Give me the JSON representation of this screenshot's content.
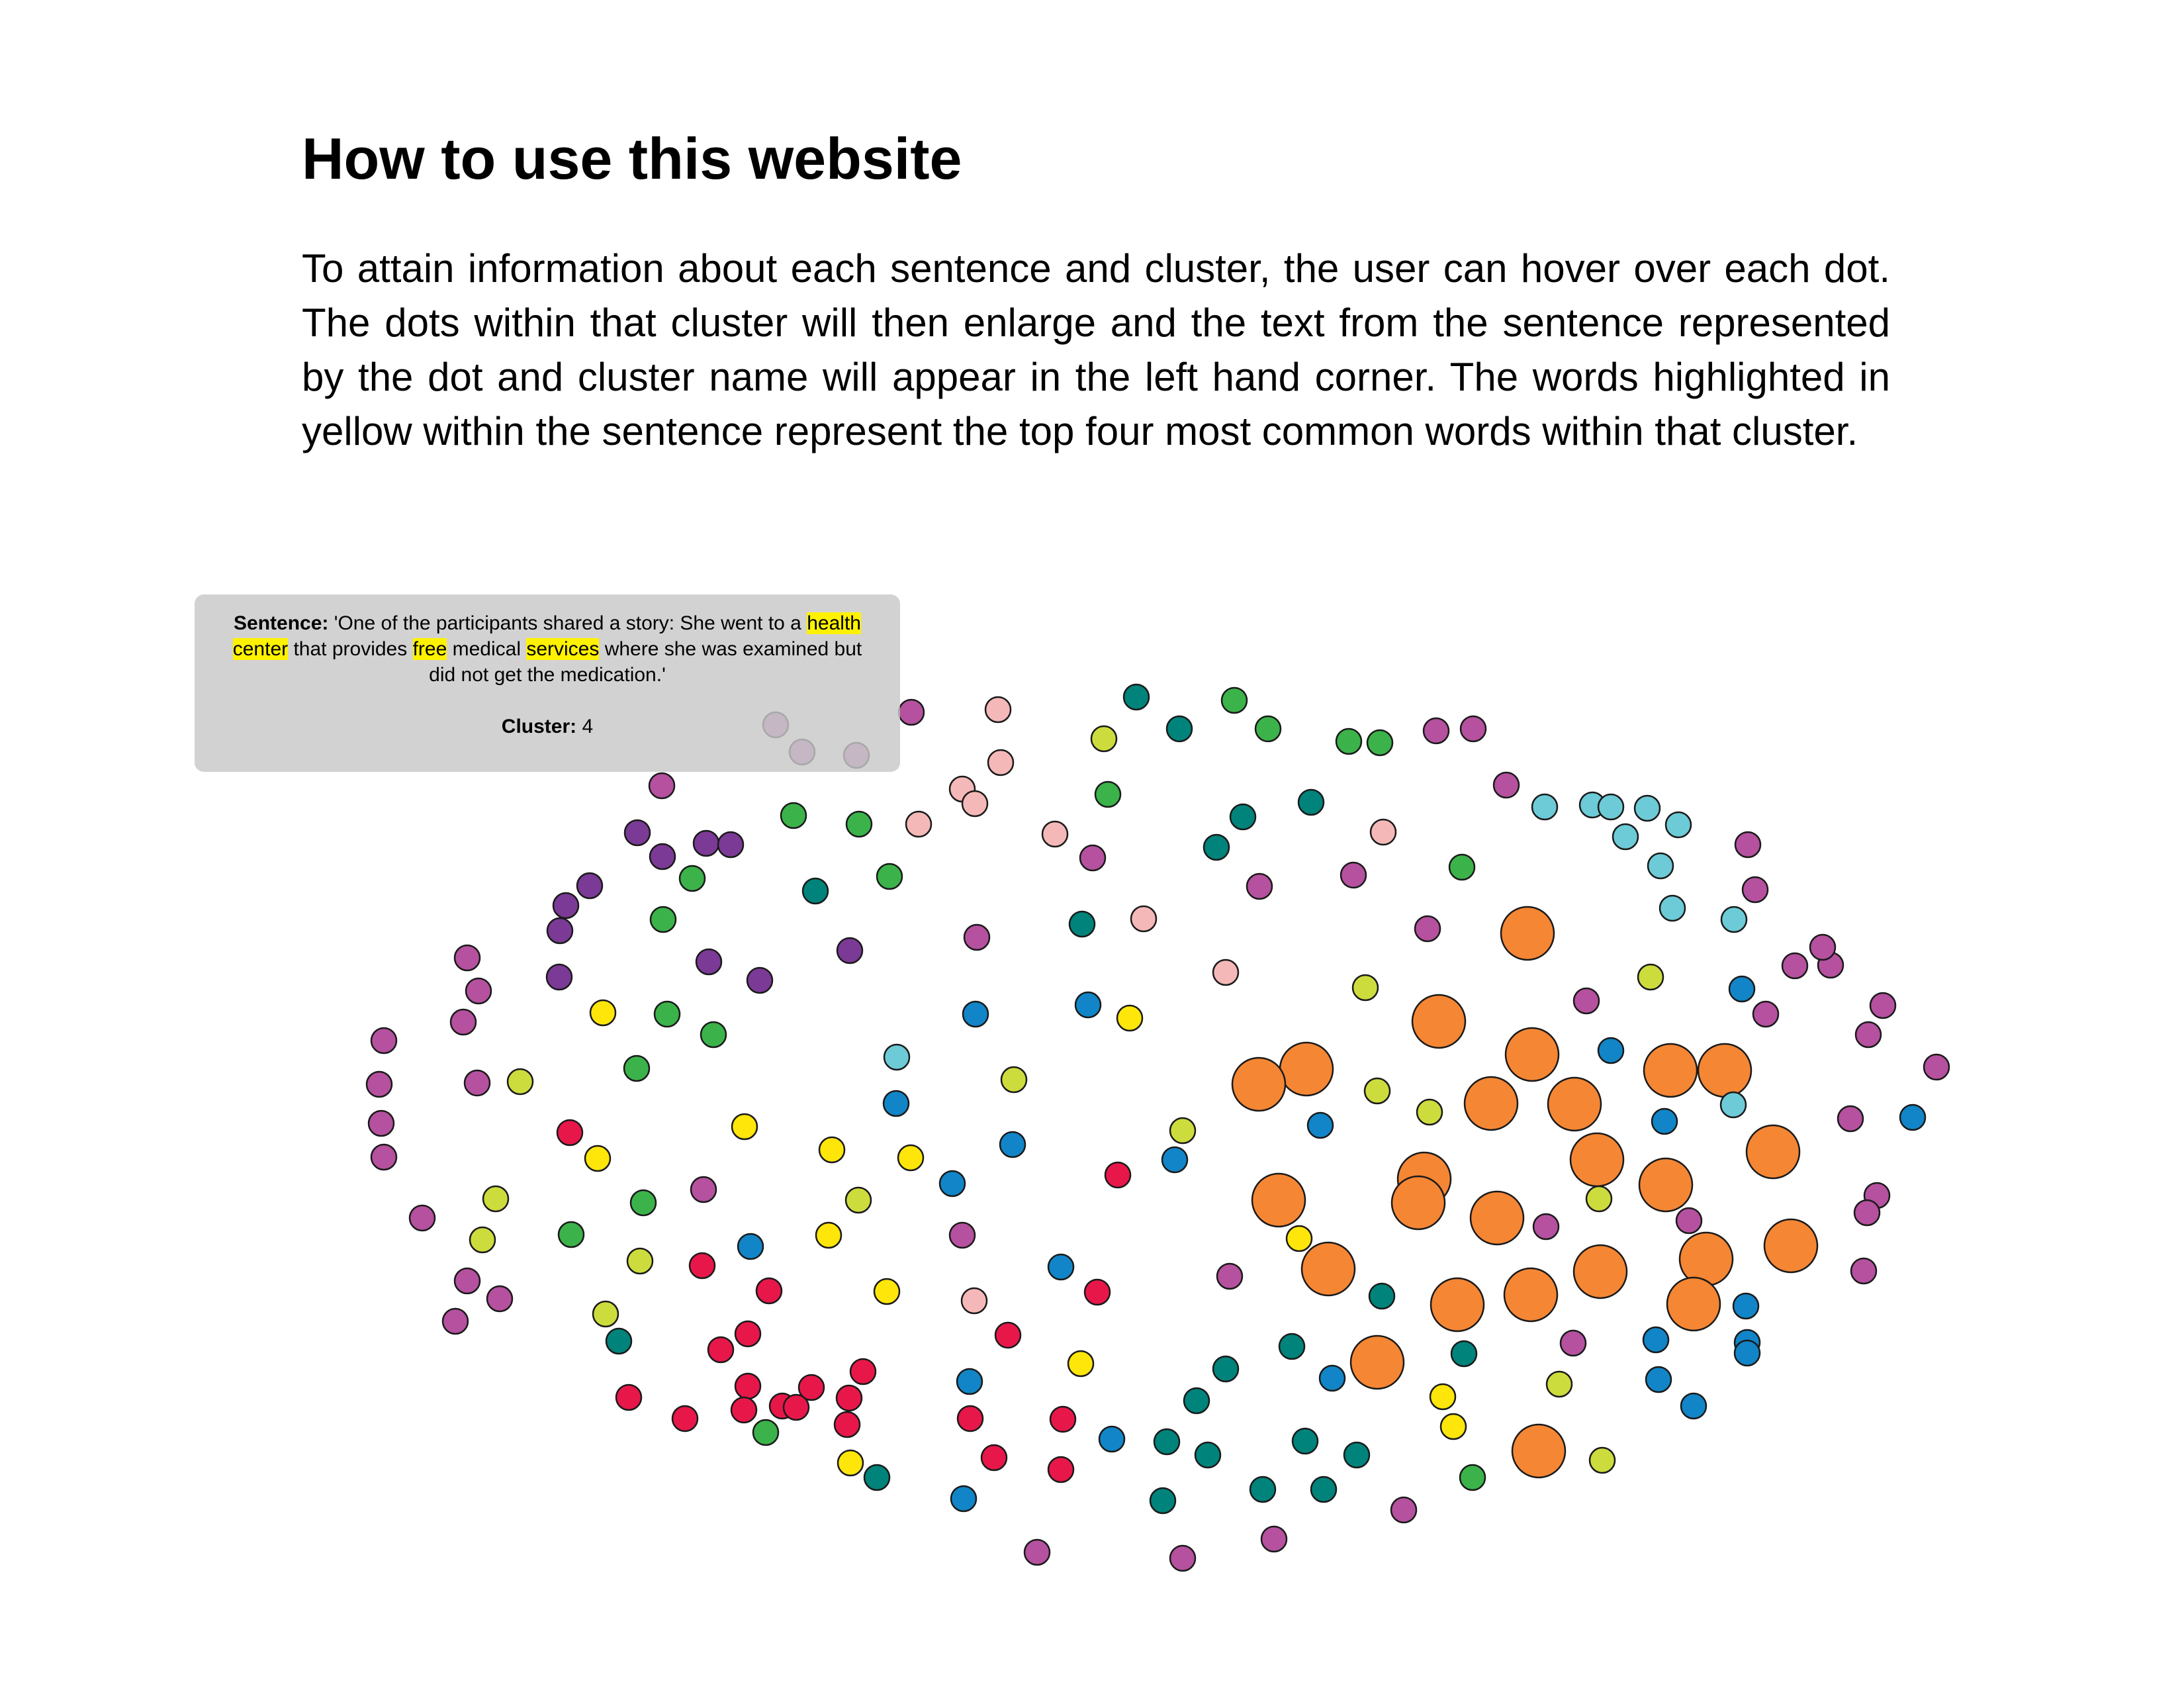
{
  "title": "How to use this website",
  "intro": "To attain information about each sentence and cluster, the user can hover over each dot.  The dots within that cluster will then enlarge and the text from the sentence represented by the dot and cluster name will appear in the left hand corner.  The words highlighted in yellow within the sentence represent the top four most common words within that cluster.",
  "tooltip": {
    "sentence_label": "Sentence:",
    "sentence_parts": [
      {
        "text": " 'One of the participants shared a story: She went to a ",
        "highlight": false
      },
      {
        "text": "health",
        "highlight": true
      },
      {
        "text": " ",
        "highlight": false
      },
      {
        "text": "center",
        "highlight": true
      },
      {
        "text": " that provides ",
        "highlight": false
      },
      {
        "text": "free",
        "highlight": true
      },
      {
        "text": " medical ",
        "highlight": false
      },
      {
        "text": "services",
        "highlight": true
      },
      {
        "text": " where she was examined but did not get the medication.'",
        "highlight": false
      }
    ],
    "cluster_label": "Cluster:",
    "cluster_value": "4"
  },
  "colors": {
    "magenta": "#b5519f",
    "purple": "#7b3a96",
    "green": "#3bb34a",
    "teal": "#00837a",
    "lightblue": "#6ccbd6",
    "pink": "#f5b8b8",
    "lime": "#cddc3d",
    "yellow": "#ffe60a",
    "red": "#e8174a",
    "blue": "#1185c7",
    "orange": "#f58634",
    "lavender": "#b768b0"
  },
  "dots": [
    [
      1717,
      1053,
      "teal"
    ],
    [
      1865,
      1058,
      "green"
    ],
    [
      1508,
      1072,
      "pink"
    ],
    [
      1377,
      1076,
      "magenta"
    ],
    [
      1668,
      1116,
      "lime"
    ],
    [
      1782,
      1101,
      "teal"
    ],
    [
      1916,
      1101,
      "green"
    ],
    [
      2038,
      1120,
      "green"
    ],
    [
      2085,
      1122,
      "green"
    ],
    [
      2170,
      1104,
      "magenta"
    ],
    [
      2226,
      1101,
      "magenta"
    ],
    [
      1512,
      1152,
      "pink"
    ],
    [
      1000,
      1187,
      "magenta"
    ],
    [
      1674,
      1200,
      "green"
    ],
    [
      1454,
      1192,
      "pink"
    ],
    [
      1473,
      1214,
      "pink"
    ],
    [
      1388,
      1245,
      "pink"
    ],
    [
      1199,
      1232,
      "green"
    ],
    [
      1298,
      1245,
      "green"
    ],
    [
      1878,
      1234,
      "teal"
    ],
    [
      1981,
      1212,
      "teal"
    ],
    [
      2090,
      1257,
      "pink"
    ],
    [
      2276,
      1186,
      "magenta"
    ],
    [
      2334,
      1219,
      "lightblue"
    ],
    [
      2406,
      1216,
      "lightblue"
    ],
    [
      2434,
      1219,
      "lightblue"
    ],
    [
      2489,
      1221,
      "lightblue"
    ],
    [
      2536,
      1246,
      "lightblue"
    ],
    [
      2456,
      1264,
      "lightblue"
    ],
    [
      963,
      1258,
      "purple"
    ],
    [
      1001,
      1294,
      "purple"
    ],
    [
      1067,
      1274,
      "purple"
    ],
    [
      1104,
      1276,
      "purple"
    ],
    [
      1046,
      1327,
      "green"
    ],
    [
      1594,
      1260,
      "pink"
    ],
    [
      1651,
      1296,
      "magenta"
    ],
    [
      1838,
      1280,
      "teal"
    ],
    [
      1232,
      1346,
      "teal"
    ],
    [
      1344,
      1324,
      "green"
    ],
    [
      2045,
      1322,
      "magenta"
    ],
    [
      2209,
      1310,
      "green"
    ],
    [
      2509,
      1308,
      "lightblue"
    ],
    [
      2641,
      1276,
      "magenta"
    ],
    [
      2652,
      1344,
      "magenta"
    ],
    [
      855,
      1368,
      "purple"
    ],
    [
      891,
      1338,
      "purple"
    ],
    [
      846,
      1406,
      "purple"
    ],
    [
      1903,
      1339,
      "magenta"
    ],
    [
      2527,
      1372,
      "lightblue"
    ],
    [
      2620,
      1389,
      "lightblue"
    ],
    [
      1002,
      1389,
      "green"
    ],
    [
      1728,
      1388,
      "pink"
    ],
    [
      1635,
      1396,
      "teal"
    ],
    [
      1476,
      1416,
      "magenta"
    ],
    [
      1284,
      1436,
      "purple"
    ],
    [
      1071,
      1453,
      "purple"
    ],
    [
      1148,
      1481,
      "purple"
    ],
    [
      845,
      1476,
      "purple"
    ],
    [
      706,
      1447,
      "magenta"
    ],
    [
      723,
      1497,
      "magenta"
    ],
    [
      2157,
      1403,
      "magenta"
    ],
    [
      2308,
      1410,
      "orange",
      40
    ],
    [
      1852,
      1469,
      "pink"
    ],
    [
      2063,
      1492,
      "lime"
    ],
    [
      2494,
      1476,
      "lime"
    ],
    [
      2712,
      1459,
      "magenta"
    ],
    [
      2766,
      1458,
      "magenta"
    ],
    [
      2754,
      1431,
      "magenta"
    ],
    [
      2632,
      1494,
      "blue"
    ],
    [
      2668,
      1532,
      "magenta"
    ],
    [
      2845,
      1519,
      "magenta"
    ],
    [
      2823,
      1563,
      "magenta"
    ],
    [
      700,
      1544,
      "magenta"
    ],
    [
      580,
      1572,
      "magenta"
    ],
    [
      911,
      1530,
      "yellow"
    ],
    [
      1008,
      1532,
      "green"
    ],
    [
      1078,
      1563,
      "green"
    ],
    [
      1474,
      1532,
      "blue"
    ],
    [
      1644,
      1518,
      "blue"
    ],
    [
      1707,
      1538,
      "yellow"
    ],
    [
      2174,
      1543,
      "orange",
      40
    ],
    [
      2397,
      1512,
      "magenta"
    ],
    [
      962,
      1614,
      "green"
    ],
    [
      1355,
      1597,
      "lightblue"
    ],
    [
      573,
      1638,
      "magenta"
    ],
    [
      576,
      1697,
      "magenta"
    ],
    [
      580,
      1748,
      "magenta"
    ],
    [
      721,
      1636,
      "magenta"
    ],
    [
      786,
      1634,
      "lime"
    ],
    [
      1532,
      1631,
      "lime"
    ],
    [
      1354,
      1667,
      "blue"
    ],
    [
      1974,
      1615,
      "orange",
      40
    ],
    [
      1902,
      1638,
      "orange",
      40
    ],
    [
      2315,
      1593,
      "orange",
      40
    ],
    [
      2434,
      1587,
      "blue"
    ],
    [
      2081,
      1648,
      "lime"
    ],
    [
      2524,
      1617,
      "orange",
      40
    ],
    [
      2606,
      1617,
      "orange",
      40
    ],
    [
      2926,
      1612,
      "magenta"
    ],
    [
      2619,
      1669,
      "lightblue"
    ],
    [
      2890,
      1688,
      "blue"
    ],
    [
      2796,
      1690,
      "magenta"
    ],
    [
      2253,
      1667,
      "orange",
      40
    ],
    [
      2379,
      1668,
      "orange",
      40
    ],
    [
      861,
      1711,
      "red"
    ],
    [
      903,
      1750,
      "yellow"
    ],
    [
      1125,
      1702,
      "yellow"
    ],
    [
      1257,
      1737,
      "yellow"
    ],
    [
      1376,
      1749,
      "yellow"
    ],
    [
      1530,
      1729,
      "blue"
    ],
    [
      1787,
      1708,
      "lime"
    ],
    [
      1995,
      1700,
      "blue"
    ],
    [
      2160,
      1680,
      "lime"
    ],
    [
      2515,
      1694,
      "blue"
    ],
    [
      2679,
      1740,
      "orange",
      40
    ],
    [
      2413,
      1752,
      "orange",
      40
    ],
    [
      1439,
      1788,
      "blue"
    ],
    [
      1689,
      1775,
      "red"
    ],
    [
      1775,
      1752,
      "blue"
    ],
    [
      1063,
      1797,
      "magenta"
    ],
    [
      1297,
      1813,
      "lime"
    ],
    [
      749,
      1811,
      "lime"
    ],
    [
      972,
      1817,
      "green"
    ],
    [
      2152,
      1781,
      "orange",
      40
    ],
    [
      2517,
      1790,
      "orange",
      40
    ],
    [
      2143,
      1817,
      "orange",
      40
    ],
    [
      1932,
      1813,
      "orange",
      40
    ],
    [
      2836,
      1806,
      "magenta"
    ],
    [
      2821,
      1832,
      "magenta"
    ],
    [
      2416,
      1811,
      "lime"
    ],
    [
      638,
      1840,
      "magenta"
    ],
    [
      729,
      1873,
      "lime"
    ],
    [
      863,
      1865,
      "green"
    ],
    [
      1134,
      1883,
      "blue"
    ],
    [
      1252,
      1866,
      "yellow"
    ],
    [
      1454,
      1866,
      "magenta"
    ],
    [
      1963,
      1871,
      "yellow"
    ],
    [
      2262,
      1840,
      "orange",
      40
    ],
    [
      2336,
      1853,
      "magenta"
    ],
    [
      2552,
      1844,
      "magenta"
    ],
    [
      967,
      1905,
      "lime"
    ],
    [
      1061,
      1912,
      "red"
    ],
    [
      1603,
      1914,
      "blue"
    ],
    [
      1858,
      1928,
      "magenta"
    ],
    [
      2007,
      1917,
      "orange",
      40
    ],
    [
      2418,
      1921,
      "orange",
      40
    ],
    [
      2578,
      1902,
      "orange",
      40
    ],
    [
      2706,
      1882,
      "orange",
      40
    ],
    [
      706,
      1935,
      "magenta"
    ],
    [
      755,
      1962,
      "magenta"
    ],
    [
      1162,
      1950,
      "red"
    ],
    [
      1340,
      1951,
      "yellow"
    ],
    [
      1472,
      1965,
      "pink"
    ],
    [
      1658,
      1952,
      "red"
    ],
    [
      2088,
      1958,
      "teal"
    ],
    [
      2202,
      1971,
      "orange",
      40
    ],
    [
      2313,
      1956,
      "orange",
      40
    ],
    [
      2559,
      1970,
      "orange",
      40
    ],
    [
      2816,
      1920,
      "magenta"
    ],
    [
      688,
      1996,
      "magenta"
    ],
    [
      915,
      1985,
      "lime"
    ],
    [
      1130,
      2015,
      "red"
    ],
    [
      1523,
      2017,
      "red"
    ],
    [
      935,
      2026,
      "teal"
    ],
    [
      1089,
      2039,
      "red"
    ],
    [
      1952,
      2034,
      "teal"
    ],
    [
      2081,
      2058,
      "orange",
      40
    ],
    [
      2212,
      2045,
      "teal"
    ],
    [
      2377,
      2029,
      "magenta"
    ],
    [
      2502,
      2024,
      "blue"
    ],
    [
      2638,
      1973,
      "blue"
    ],
    [
      2640,
      2028,
      "blue"
    ],
    [
      2640,
      2044,
      "blue"
    ],
    [
      1304,
      2072,
      "red"
    ],
    [
      1633,
      2060,
      "yellow"
    ],
    [
      1852,
      2068,
      "teal"
    ],
    [
      2013,
      2082,
      "blue"
    ],
    [
      2356,
      2091,
      "lime"
    ],
    [
      2506,
      2084,
      "blue"
    ],
    [
      1130,
      2094,
      "red"
    ],
    [
      950,
      2111,
      "red"
    ],
    [
      1226,
      2096,
      "red"
    ],
    [
      1182,
      2124,
      "red"
    ],
    [
      1283,
      2112,
      "red"
    ],
    [
      1465,
      2087,
      "blue"
    ],
    [
      1808,
      2116,
      "teal"
    ],
    [
      2180,
      2110,
      "yellow"
    ],
    [
      2559,
      2124,
      "blue"
    ],
    [
      1035,
      2143,
      "red"
    ],
    [
      1124,
      2130,
      "red"
    ],
    [
      1203,
      2126,
      "red"
    ],
    [
      1280,
      2152,
      "red"
    ],
    [
      1466,
      2143,
      "red"
    ],
    [
      1606,
      2144,
      "red"
    ],
    [
      2196,
      2155,
      "yellow"
    ],
    [
      1157,
      2164,
      "green"
    ],
    [
      1680,
      2174,
      "blue"
    ],
    [
      1763,
      2178,
      "teal"
    ],
    [
      1825,
      2198,
      "teal"
    ],
    [
      1972,
      2177,
      "teal"
    ],
    [
      2050,
      2198,
      "teal"
    ],
    [
      2325,
      2192,
      "orange",
      40
    ],
    [
      2421,
      2206,
      "lime"
    ],
    [
      1502,
      2202,
      "red"
    ],
    [
      1603,
      2220,
      "red"
    ],
    [
      1285,
      2210,
      "yellow"
    ],
    [
      1325,
      2232,
      "teal"
    ],
    [
      2225,
      2232,
      "green"
    ],
    [
      1908,
      2250,
      "teal"
    ],
    [
      2000,
      2250,
      "teal"
    ],
    [
      1456,
      2264,
      "blue"
    ],
    [
      1757,
      2267,
      "teal"
    ],
    [
      2121,
      2281,
      "magenta"
    ],
    [
      1925,
      2325,
      "magenta"
    ],
    [
      1567,
      2345,
      "magenta"
    ],
    [
      1787,
      2354,
      "magenta"
    ],
    [
      1172,
      1095,
      "lavender"
    ],
    [
      1212,
      1136,
      "lavender"
    ],
    [
      1294,
      1141,
      "lavender"
    ]
  ]
}
